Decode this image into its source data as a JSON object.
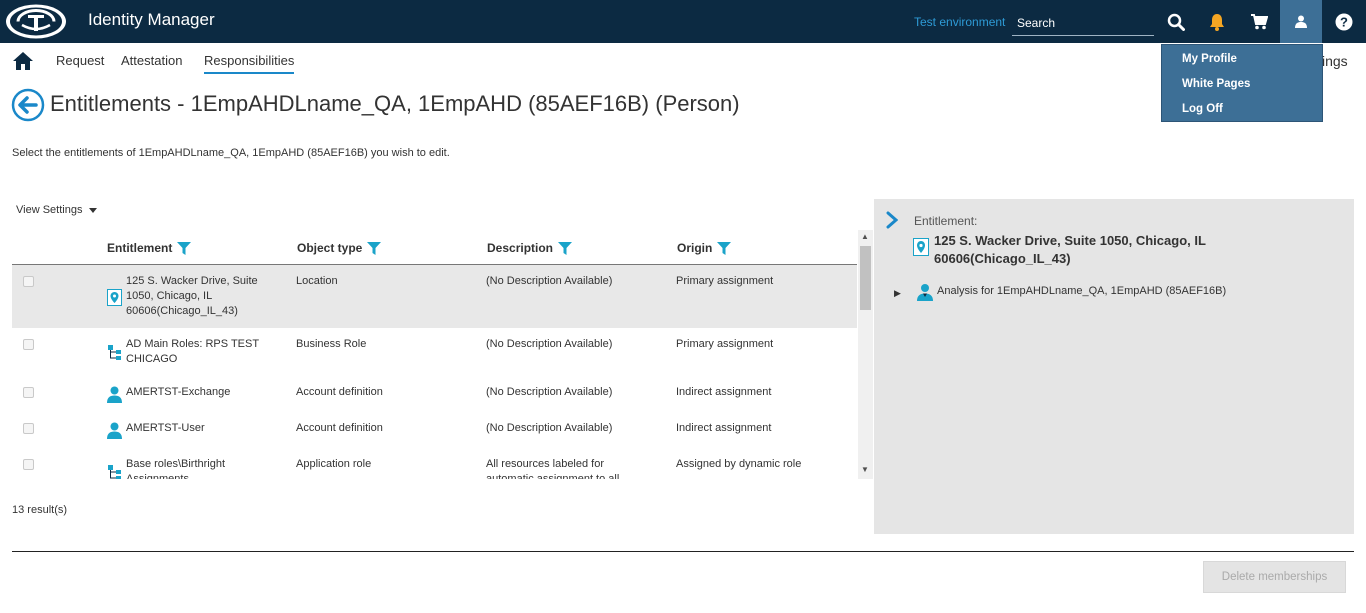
{
  "topbar": {
    "app_title": "Identity Manager",
    "environment": "Test environment",
    "search_placeholder": "Search"
  },
  "nav": {
    "items": [
      "Request",
      "Attestation",
      "Responsibilities"
    ],
    "active": "Responsibilities",
    "truncated_text": "ings"
  },
  "user_menu": {
    "items": [
      "My Profile",
      "White Pages",
      "Log Off"
    ]
  },
  "page": {
    "title": "Entitlements - 1EmpAHDLname_QA, 1EmpAHD (85AEF16B) (Person)",
    "instruction": "Select the entitlements of 1EmpAHDLname_QA, 1EmpAHD (85AEF16B) you wish to edit.",
    "view_settings": "View Settings"
  },
  "grid": {
    "columns": [
      "Entitlement",
      "Object type",
      "Description",
      "Origin"
    ],
    "rows": [
      {
        "icon": "location-icon",
        "entitlement": "125 S. Wacker Drive, Suite 1050, Chicago, IL 60606(Chicago_IL_43)",
        "object_type": "Location",
        "description": "(No Description Available)",
        "origin": "Primary assignment",
        "selected": true
      },
      {
        "icon": "business-role-icon",
        "entitlement": "AD Main Roles: RPS TEST CHICAGO",
        "object_type": "Business Role",
        "description": "(No Description Available)",
        "origin": "Primary assignment",
        "selected": false
      },
      {
        "icon": "person-icon",
        "entitlement": "AMERTST-Exchange",
        "object_type": "Account definition",
        "description": "(No Description Available)",
        "origin": "Indirect assignment",
        "selected": false
      },
      {
        "icon": "person-icon",
        "entitlement": "AMERTST-User",
        "object_type": "Account definition",
        "description": "(No Description Available)",
        "origin": "Indirect assignment",
        "selected": false
      },
      {
        "icon": "business-role-icon",
        "entitlement": "Base roles\\Birthright Assignments",
        "object_type": "Application role",
        "description": "All resources labeled for automatic assignment to all",
        "origin": "Assigned by dynamic role",
        "selected": false
      }
    ],
    "results": "13 result(s)"
  },
  "detail_panel": {
    "label": "Entitlement:",
    "value": "125 S. Wacker Drive, Suite 1050, Chicago, IL 60606(Chicago_IL_43)",
    "analysis": "Analysis for 1EmpAHDLname_QA, 1EmpAHD (85AEF16B)"
  },
  "actions": {
    "delete_memberships": "Delete memberships"
  },
  "colors": {
    "topbar_bg": "#0c2a42",
    "accent": "#1aa3c9",
    "menu_bg": "#3d6f96",
    "notification": "#f5a623"
  }
}
